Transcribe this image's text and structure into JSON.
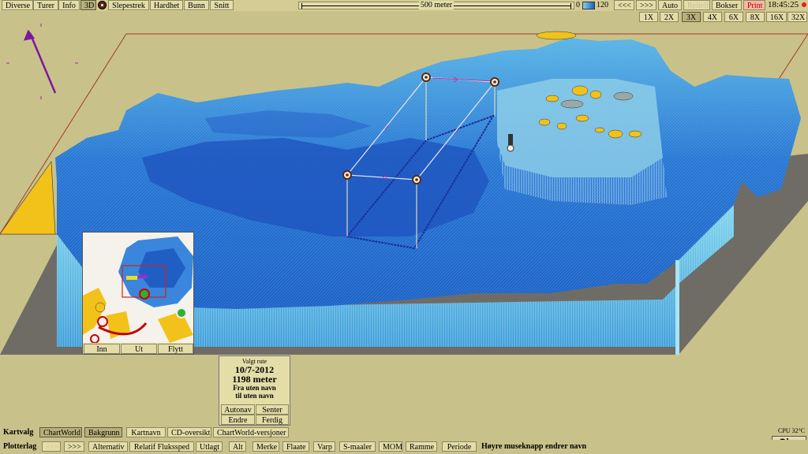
{
  "top_menu": {
    "items": [
      "Diverse",
      "Turer",
      "Info",
      "3D",
      "Slepestrek",
      "Hardhet",
      "Bunn",
      "Snitt"
    ],
    "active": "3D",
    "scale_label": "500 meter",
    "depth_min": "0",
    "depth_max": "120",
    "nav_prev": "<<<",
    "nav_next": ">>>",
    "auto": "Auto",
    "relieff": "Relieff",
    "bokser": "Bokser",
    "print": "Print",
    "clock": "18:45:25"
  },
  "zoom": {
    "options": [
      "1X",
      "2X",
      "3X",
      "4X",
      "6X",
      "8X",
      "16X",
      "32X"
    ],
    "active": "3X"
  },
  "minimap": {
    "in": "Inn",
    "out": "Ut",
    "move": "Flytt"
  },
  "route_panel": {
    "heading": "Valgt rute",
    "date": "10/7-2012",
    "distance": "1198 meter",
    "from": "Fra uten navn",
    "to": "til uten navn",
    "autonav": "Autonav",
    "center": "Senter",
    "edit": "Endre",
    "done": "Ferdig"
  },
  "bottom_row1": {
    "title": "Kartvalg",
    "items": [
      "ChartWorld",
      "Bakgrunn",
      "Kartnavn",
      "CD-oversikt",
      "ChartWorld-versjoner"
    ],
    "active": [
      "ChartWorld",
      "Bakgrunn"
    ]
  },
  "bottom_row2": {
    "title": "Plotterlag",
    "prev": "<<<",
    "next": ">>>",
    "items": [
      "Alternativ",
      "Relatif Flukssped",
      "Utlagt",
      "Alt",
      "Merke",
      "Flaate",
      "Varp",
      "S-maaler",
      "MOM",
      "Ramme",
      "Periode"
    ],
    "hint": "Høyre museknapp endrer navn"
  },
  "status": {
    "cpu": "CPU 32°C",
    "logo": "Olex"
  },
  "colors": {
    "background": "#c9c18a",
    "terrain_deep": "#1f5fc4",
    "terrain_shallow": "#7fd4ec",
    "land": "#f2c21a",
    "route": "#1a2f9a"
  }
}
